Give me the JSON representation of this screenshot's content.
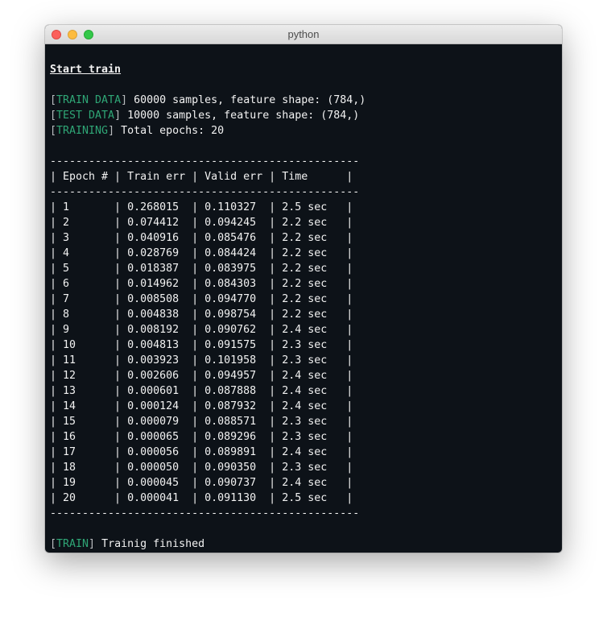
{
  "window": {
    "title": "python"
  },
  "terminal": {
    "heading": "Start train",
    "logs": [
      {
        "tag": "TRAIN DATA",
        "text": " 60000 samples, feature shape: (784,)"
      },
      {
        "tag": "TEST DATA",
        "text": " 10000 samples, feature shape: (784,)"
      },
      {
        "tag": "TRAINING",
        "text": " Total epochs: 20"
      }
    ],
    "final": {
      "tag": "TRAIN",
      "text": " Trainig finished"
    },
    "bracket_open": "[",
    "bracket_close": "]"
  },
  "table": {
    "rule": "------------------------------------------------",
    "separator": "|",
    "headers": [
      "Epoch #",
      "Train err",
      "Valid err",
      "Time"
    ],
    "rows": [
      [
        "1",
        "0.268015",
        "0.110327",
        "2.5 sec"
      ],
      [
        "2",
        "0.074412",
        "0.094245",
        "2.2 sec"
      ],
      [
        "3",
        "0.040916",
        "0.085476",
        "2.2 sec"
      ],
      [
        "4",
        "0.028769",
        "0.084424",
        "2.2 sec"
      ],
      [
        "5",
        "0.018387",
        "0.083975",
        "2.2 sec"
      ],
      [
        "6",
        "0.014962",
        "0.084303",
        "2.2 sec"
      ],
      [
        "7",
        "0.008508",
        "0.094770",
        "2.2 sec"
      ],
      [
        "8",
        "0.004838",
        "0.098754",
        "2.2 sec"
      ],
      [
        "9",
        "0.008192",
        "0.090762",
        "2.4 sec"
      ],
      [
        "10",
        "0.004813",
        "0.091575",
        "2.3 sec"
      ],
      [
        "11",
        "0.003923",
        "0.101958",
        "2.3 sec"
      ],
      [
        "12",
        "0.002606",
        "0.094957",
        "2.4 sec"
      ],
      [
        "13",
        "0.000601",
        "0.087888",
        "2.4 sec"
      ],
      [
        "14",
        "0.000124",
        "0.087932",
        "2.4 sec"
      ],
      [
        "15",
        "0.000079",
        "0.088571",
        "2.3 sec"
      ],
      [
        "16",
        "0.000065",
        "0.089296",
        "2.3 sec"
      ],
      [
        "17",
        "0.000056",
        "0.089891",
        "2.4 sec"
      ],
      [
        "18",
        "0.000050",
        "0.090350",
        "2.3 sec"
      ],
      [
        "19",
        "0.000045",
        "0.090737",
        "2.4 sec"
      ],
      [
        "20",
        "0.000041",
        "0.091130",
        "2.5 sec"
      ]
    ]
  },
  "colors": {
    "background": "#0d1218",
    "tag": "#2fa676",
    "text": "#f2f2f2"
  }
}
